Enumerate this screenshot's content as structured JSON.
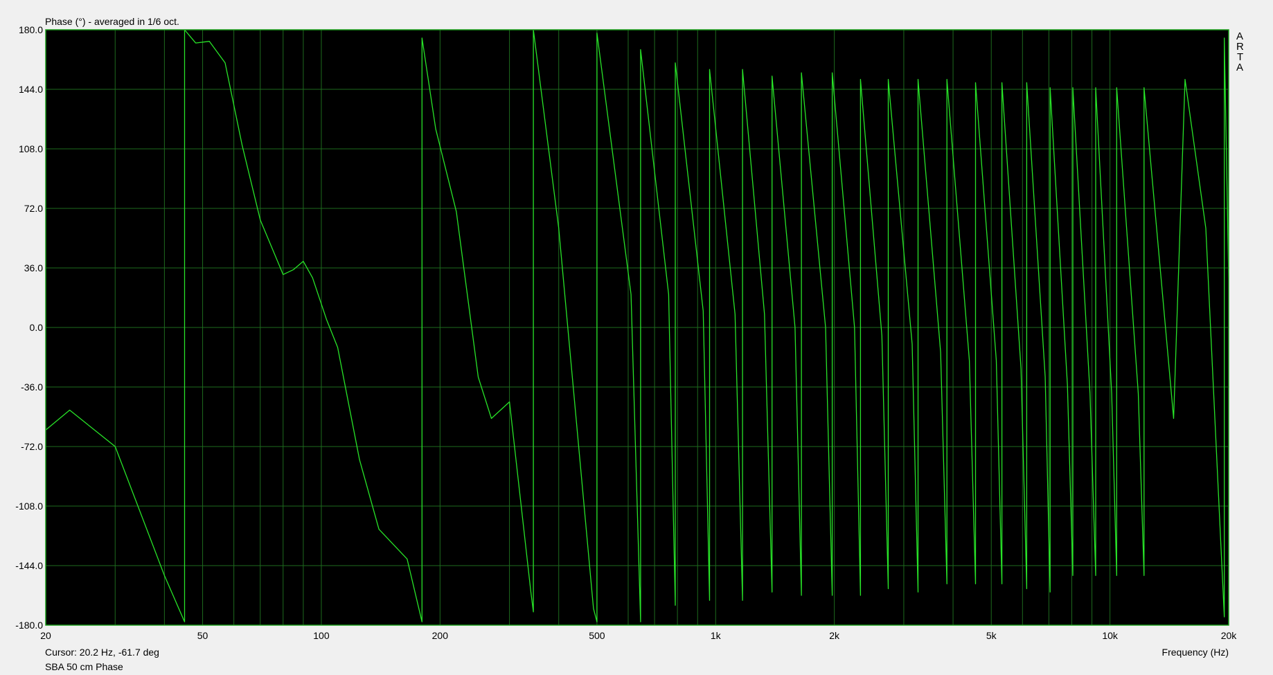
{
  "window": {
    "title": "Phase (°) - averaged in 1/6 oct.",
    "cursor_readout": "Cursor: 20.2 Hz, -61.7 deg",
    "trace_name": "SBA 50 cm Phase",
    "brand": "ARTA"
  },
  "colors": {
    "background": "#f0f0f0",
    "plot_bg": "#000000",
    "grid": "#1e6b1e",
    "trace": "#28e428",
    "frame": "#1a9e1a"
  },
  "chart_data": {
    "type": "line",
    "title": "Phase (°) - averaged in 1/6 oct.",
    "xlabel": "Frequency (Hz)",
    "ylabel": "",
    "xscale": "log",
    "xlim": [
      20,
      20000
    ],
    "ylim": [
      -180,
      180
    ],
    "grid": true,
    "x_ticks": [
      {
        "value": 20,
        "label": "20"
      },
      {
        "value": 50,
        "label": "50"
      },
      {
        "value": 100,
        "label": "100"
      },
      {
        "value": 200,
        "label": "200"
      },
      {
        "value": 500,
        "label": "500"
      },
      {
        "value": 1000,
        "label": "1k"
      },
      {
        "value": 2000,
        "label": "2k"
      },
      {
        "value": 5000,
        "label": "5k"
      },
      {
        "value": 10000,
        "label": "10k"
      },
      {
        "value": 20000,
        "label": "20k"
      }
    ],
    "y_ticks": [
      {
        "value": 180,
        "label": "180.0"
      },
      {
        "value": 144,
        "label": "144.0"
      },
      {
        "value": 108,
        "label": "108.0"
      },
      {
        "value": 72,
        "label": "72.0"
      },
      {
        "value": 36,
        "label": "36.0"
      },
      {
        "value": 0,
        "label": "0.0"
      },
      {
        "value": -36,
        "label": "-36.0"
      },
      {
        "value": -72,
        "label": "-72.0"
      },
      {
        "value": -108,
        "label": "-108.0"
      },
      {
        "value": -144,
        "label": "-144.0"
      },
      {
        "value": -180,
        "label": "-180.0"
      }
    ],
    "series": [
      {
        "name": "SBA 50 cm Phase",
        "x": [
          20,
          23,
          30,
          40,
          45,
          45,
          48,
          52,
          57,
          63,
          70,
          80,
          85,
          90,
          95,
          103,
          110,
          125,
          140,
          165,
          180,
          180,
          195,
          220,
          250,
          270,
          300,
          340,
          345,
          345,
          400,
          490,
          500,
          500,
          610,
          645,
          645,
          760,
          790,
          790,
          930,
          965,
          965,
          1120,
          1170,
          1170,
          1330,
          1390,
          1390,
          1590,
          1650,
          1650,
          1900,
          1975,
          1975,
          2250,
          2330,
          2330,
          2640,
          2740,
          2740,
          3150,
          3260,
          3260,
          3720,
          3860,
          3860,
          4400,
          4560,
          4560,
          5150,
          5320,
          5320,
          5950,
          6150,
          6150,
          6850,
          7050,
          7050,
          7800,
          8050,
          8050,
          8900,
          9200,
          9200,
          10100,
          10400,
          10400,
          11800,
          12200,
          12200,
          14500,
          15500,
          17500,
          19500,
          19500,
          20000
        ],
        "y": [
          -62,
          -50,
          -72,
          -150,
          -178,
          180,
          172,
          173,
          160,
          110,
          65,
          32,
          35,
          40,
          30,
          5,
          -12,
          -80,
          -122,
          -140,
          -178,
          175,
          120,
          70,
          -30,
          -55,
          -45,
          -160,
          -172,
          180,
          60,
          -170,
          -178,
          178,
          20,
          -178,
          168,
          20,
          -168,
          160,
          10,
          -165,
          156,
          8,
          -165,
          156,
          8,
          -160,
          152,
          0,
          -162,
          154,
          0,
          -162,
          154,
          0,
          -162,
          150,
          -5,
          -158,
          150,
          -10,
          -160,
          150,
          -15,
          -155,
          150,
          -20,
          -155,
          148,
          -20,
          -155,
          148,
          -25,
          -158,
          148,
          -30,
          -160,
          145,
          -35,
          -150,
          145,
          -40,
          -150,
          145,
          -40,
          -150,
          145,
          -40,
          -150,
          145,
          -55,
          150,
          60,
          -175,
          175,
          30
        ]
      }
    ]
  }
}
